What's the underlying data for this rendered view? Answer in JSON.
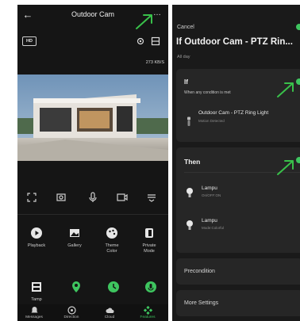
{
  "left_phone": {
    "title": "Outdoor Cam",
    "hd_badge": "HD",
    "bitrate": "273 KB/S",
    "features_row1": [
      {
        "icon": "play-icon",
        "label": "Playback"
      },
      {
        "icon": "gallery-icon",
        "label": "Gallery"
      },
      {
        "icon": "palette-icon",
        "label": "Theme\nColor"
      },
      {
        "icon": "privacy-icon",
        "label": "Private\nMode"
      }
    ],
    "features_row2": [
      {
        "icon": "tamper-icon",
        "label": "Tamp"
      }
    ],
    "bottom_nav": [
      {
        "icon": "bell-icon",
        "label": "Messages"
      },
      {
        "icon": "direction-icon",
        "label": "Direction"
      },
      {
        "icon": "cloud-icon",
        "label": "Cloud"
      },
      {
        "icon": "features-icon",
        "label": "Features"
      }
    ]
  },
  "right_phone": {
    "cancel_label": "Cancel",
    "rule_title": "If Outdoor Cam - PTZ Rin...",
    "rule_subtitle": "All day",
    "if_section": {
      "heading": "If",
      "subheading": "When any condition is met",
      "condition": {
        "title": "Outdoor Cam - PTZ Ring Light",
        "subtitle": "Motion Detected"
      }
    },
    "then_section": {
      "heading": "Then",
      "actions": [
        {
          "title": "Lampu",
          "subtitle": "On/OFF:ON"
        },
        {
          "title": "Lampu",
          "subtitle": "Mode:Colorful"
        }
      ]
    },
    "precondition_label": "Precondition",
    "more_settings_label": "More Settings"
  },
  "colors": {
    "accent": "#3ec55f",
    "annotation": "#39c14a"
  }
}
